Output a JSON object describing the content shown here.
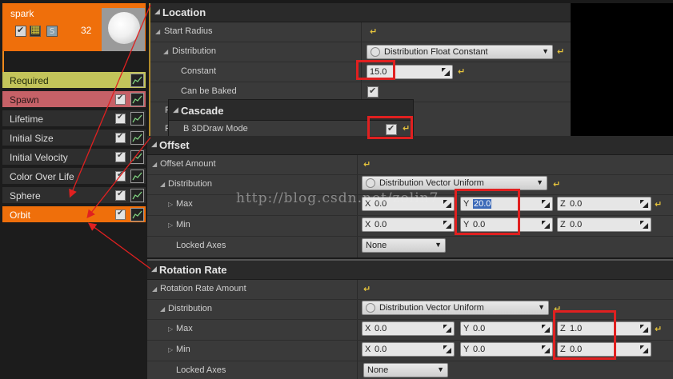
{
  "emitter": {
    "name": "spark",
    "count": "32",
    "solo_label": "S",
    "modules": [
      {
        "label": "Required"
      },
      {
        "label": "Spawn"
      },
      {
        "label": "Lifetime"
      },
      {
        "label": "Initial Size"
      },
      {
        "label": "Initial Velocity"
      },
      {
        "label": "Color Over Life"
      },
      {
        "label": "Sphere"
      },
      {
        "label": "Orbit"
      }
    ]
  },
  "location": {
    "title": "Location",
    "start_radius": "Start Radius",
    "distribution": "Distribution",
    "distribution_value": "Distribution Float Constant",
    "constant": "Constant",
    "constant_value": "15.0",
    "can_be_baked": "Can be Baked",
    "hidden_letter": "F"
  },
  "cascade": {
    "title": "Cascade",
    "draw_mode": "B 3DDraw Mode"
  },
  "offset": {
    "title": "Offset",
    "offset_amount": "Offset Amount",
    "distribution": "Distribution",
    "distribution_value": "Distribution Vector Uniform",
    "max": "Max",
    "min": "Min",
    "locked_axes": "Locked Axes",
    "locked_axes_value": "None",
    "max_x": "0.0",
    "max_y": "20.0",
    "max_z": "0.0",
    "min_x": "0.0",
    "min_y": "0.0",
    "min_z": "0.0"
  },
  "rotation": {
    "title": "Rotation Rate",
    "amount": "Rotation Rate Amount",
    "distribution": "Distribution",
    "distribution_value": "Distribution Vector Uniform",
    "max": "Max",
    "min": "Min",
    "locked_axes": "Locked Axes",
    "locked_axes_value": "None",
    "max_x": "0.0",
    "max_y": "0.0",
    "max_z": "1.0",
    "min_x": "0.0",
    "min_y": "0.0",
    "min_z": "0.0"
  },
  "axes": {
    "x": "X",
    "y": "Y",
    "z": "Z"
  },
  "reset_glyph": "↵",
  "watermark": "http://blog.csdn.net/zolin7"
}
